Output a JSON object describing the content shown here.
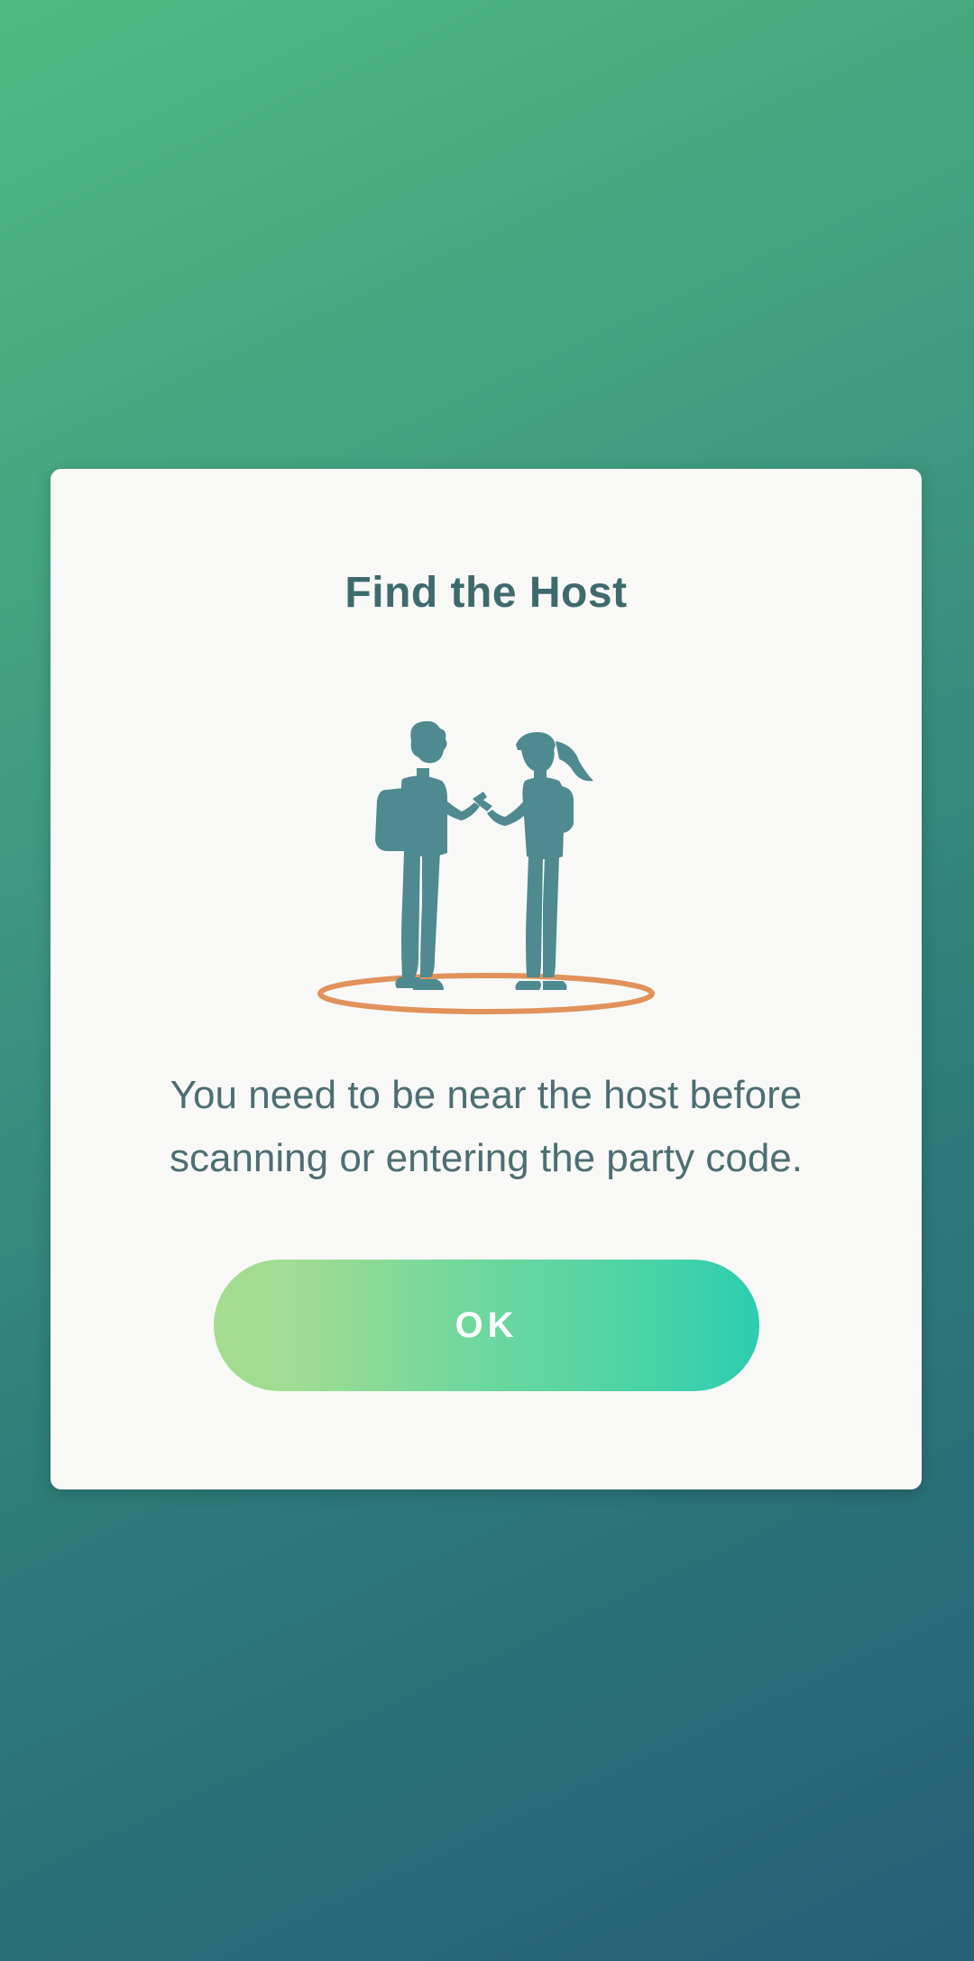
{
  "dialog": {
    "title": "Find the Host",
    "message": "You need to be near the host before scanning or entering the party code.",
    "ok_label": "OK"
  },
  "illustration": {
    "icon": "two-trainers-near-each-other-icon",
    "figure_color": "#4e8a90",
    "ring_color": "#e0925a"
  },
  "colors": {
    "background_top": "#4fba82",
    "background_bottom": "#255f76",
    "title_color": "#3f6a6c",
    "button_start": "#a4dc90",
    "button_end": "#2ccdb0"
  }
}
